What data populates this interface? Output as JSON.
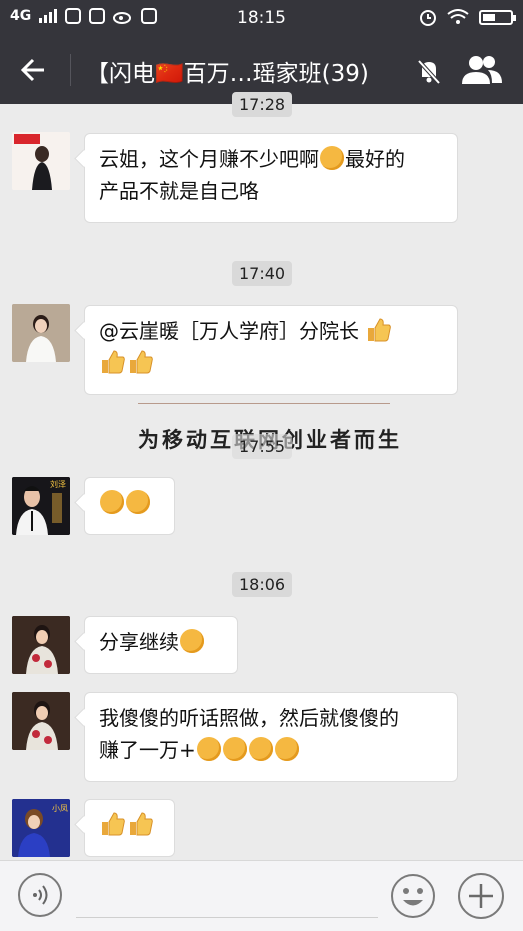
{
  "status_bar": {
    "network": "4G",
    "time": "18:15"
  },
  "header": {
    "title": "【闪电🇨🇳百万…瑶家班(39)"
  },
  "messages": [
    {
      "type": "time",
      "text": "17:28"
    },
    {
      "type": "text",
      "sender": "avatar-magazine",
      "line1": "云姐，这个月赚不少吧啊",
      "line2": "产品不就是自己咯",
      "after_emoji": "最好的"
    },
    {
      "type": "time",
      "text": "17:40"
    },
    {
      "type": "text",
      "sender": "avatar-woman-white",
      "text": "@云崖暖［万人学府］分院长"
    },
    {
      "type": "watermark",
      "text": "为移动互联网创业者而生"
    },
    {
      "type": "time",
      "text": "17:55"
    },
    {
      "type": "emoji",
      "sender": "avatar-liuze",
      "avatar_label": "刘泽"
    },
    {
      "type": "time",
      "text": "18:06"
    },
    {
      "type": "text",
      "sender": "avatar-woman-red",
      "text": "分享继续"
    },
    {
      "type": "text",
      "sender": "avatar-woman-red",
      "line1": "我傻傻的听话照做，然后就傻傻的",
      "line2": "赚了一万+"
    },
    {
      "type": "emoji",
      "sender": "avatar-xiaofeng",
      "avatar_label": "小凤"
    }
  ],
  "colors": {
    "bar": "#35353b",
    "bg": "#ebebeb",
    "bubble": "#ffffff"
  }
}
